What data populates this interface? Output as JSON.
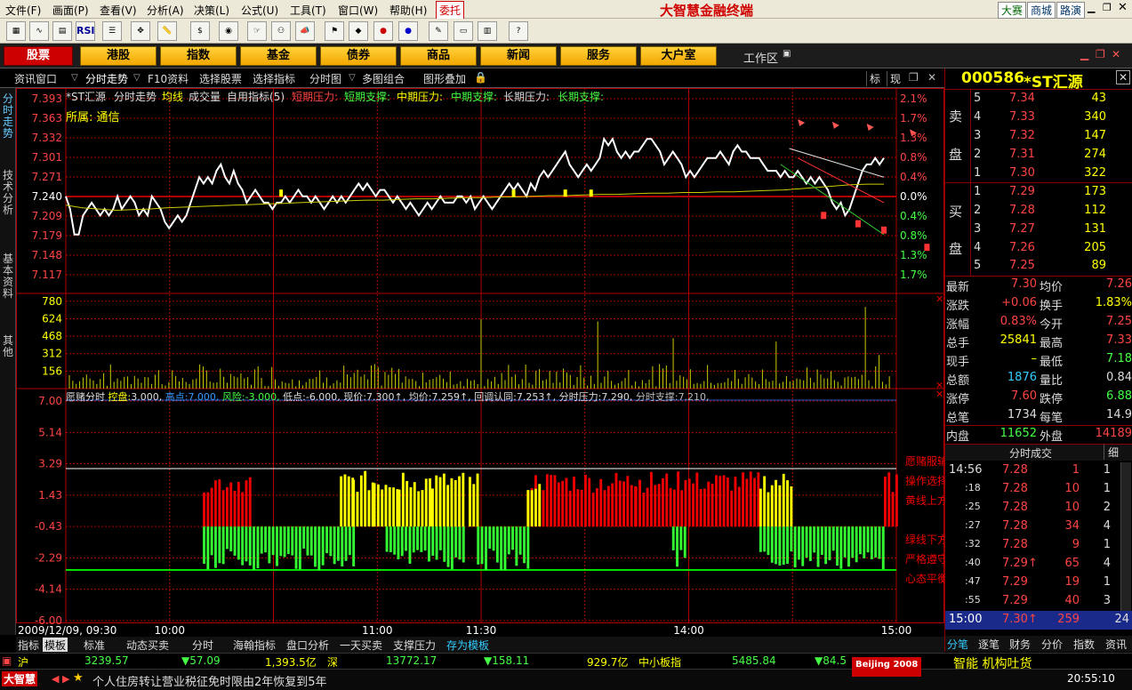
{
  "menu": {
    "items": [
      "文件(F)",
      "画面(P)",
      "查看(V)",
      "分析(A)",
      "决策(L)",
      "公式(U)",
      "工具(T)",
      "窗口(W)",
      "帮助(H)"
    ],
    "entrust": "委托",
    "app_title": "大智慧金融终端",
    "links": [
      "大赛",
      "商城",
      "路演"
    ]
  },
  "toolbar": {
    "rsi": "RSI"
  },
  "nav": {
    "buttons": [
      "股票",
      "港股",
      "指数",
      "基金",
      "债券",
      "商品",
      "新闻",
      "服务",
      "大户室"
    ],
    "workspace": "工作区"
  },
  "subtabs": {
    "items": [
      "资讯窗口",
      "分时走势",
      "F10资料",
      "选择股票",
      "选择指标",
      "分时图",
      "多图组合",
      "图形叠加"
    ],
    "right": [
      "标",
      "现"
    ]
  },
  "stock": {
    "code": "000586",
    "name": "*ST汇源"
  },
  "chart_header": {
    "name": "*ST汇源",
    "items": [
      "分时走势",
      "均线",
      "成交量",
      "自用指标(5)"
    ],
    "pressure": [
      "短期压力:",
      "短期支撑:",
      "中期压力:",
      "中期支撑:",
      "长期压力:",
      "长期支撑:"
    ],
    "sector": "所属: 通信"
  },
  "side_tabs": [
    "分时走势",
    "技术分析",
    "基本资料",
    "其他"
  ],
  "indicator_header": {
    "name": "愿赌分时",
    "kp_label": "控盘:",
    "kp": "3.000,",
    "high_label": "高点:",
    "high": "7.000,",
    "risk_label": "风险:",
    "risk": "-3.000,",
    "low_label": "低点:",
    "low": "-6.000,",
    "price_label": "现价:",
    "price": "7.300↑,",
    "avg_label": "均价:",
    "avg": "7.259↑,",
    "pull_label": "回调认同:",
    "pull": "7.253↑,",
    "press_label": "分时压力:",
    "press": "7.290,",
    "supp_label": "分时支撑:",
    "supp": "7.210,"
  },
  "right_notes": [
    "愿赌服输",
    "操作选择",
    "黄线上方",
    "绿线下方",
    "严格遵守",
    "心态平衡"
  ],
  "chart_data": [
    {
      "type": "line",
      "chart": "price",
      "ylim": [
        7.117,
        7.393
      ],
      "y_ticks_left": [
        "7.393",
        "7.363",
        "7.332",
        "7.301",
        "7.271",
        "7.240",
        "7.209",
        "7.179",
        "7.148",
        "7.117"
      ],
      "y_ticks_right": [
        "2.1%",
        "1.7%",
        "1.3%",
        "0.8%",
        "0.4%",
        "0.0%",
        "0.4%",
        "0.8%",
        "1.3%",
        "1.7%"
      ],
      "prev_close": 7.24,
      "series": [
        {
          "values": [
            7.24,
            7.22,
            7.18,
            7.18,
            7.21,
            7.22,
            7.23,
            7.22,
            7.21,
            7.22,
            7.21,
            7.22,
            7.24,
            7.22,
            7.23,
            7.24,
            7.23,
            7.21,
            7.22,
            7.21,
            7.24,
            7.23,
            7.22,
            7.2,
            7.19,
            7.2,
            7.21,
            7.2,
            7.21,
            7.23,
            7.25,
            7.27,
            7.26,
            7.27,
            7.26,
            7.28,
            7.29,
            7.27,
            7.26,
            7.28,
            7.26,
            7.25,
            7.23,
            7.24,
            7.25,
            7.24,
            7.23,
            7.23,
            7.22,
            7.23,
            7.23,
            7.24,
            7.23,
            7.24,
            7.25,
            7.24,
            7.24,
            7.23,
            7.24,
            7.23,
            7.22,
            7.23,
            7.24,
            7.23,
            7.24,
            7.23,
            7.24,
            7.25,
            7.26,
            7.25,
            7.26,
            7.25,
            7.24,
            7.25,
            7.25,
            7.24,
            7.23,
            7.24,
            7.23,
            7.22,
            7.23,
            7.22,
            7.21,
            7.22,
            7.23,
            7.22,
            7.23,
            7.24,
            7.23,
            7.23,
            7.23,
            7.24,
            7.24,
            7.23,
            7.24,
            7.22,
            7.23,
            7.24,
            7.23,
            7.22,
            7.23,
            7.24,
            7.25,
            7.26,
            7.25,
            7.26,
            7.25,
            7.24,
            7.26,
            7.25,
            7.27,
            7.28,
            7.27,
            7.28,
            7.29,
            7.3,
            7.31,
            7.29,
            7.28,
            7.27,
            7.28,
            7.29,
            7.28,
            7.29,
            7.3,
            7.33,
            7.32,
            7.33,
            7.31,
            7.3,
            7.31,
            7.3,
            7.31,
            7.31,
            7.32,
            7.33,
            7.33,
            7.32,
            7.31,
            7.29,
            7.3,
            7.31,
            7.3,
            7.29,
            7.27,
            7.28,
            7.27,
            7.28,
            7.29,
            7.3,
            7.3,
            7.3,
            7.31,
            7.3,
            7.29,
            7.31,
            7.32,
            7.31,
            7.31,
            7.3,
            7.3,
            7.3,
            7.29,
            7.28,
            7.28,
            7.28,
            7.27,
            7.28,
            7.27,
            7.27,
            7.28,
            7.27,
            7.26,
            7.27,
            7.26,
            7.27,
            7.26,
            7.25,
            7.23,
            7.22,
            7.23,
            7.21,
            7.22,
            7.24,
            7.26,
            7.28,
            7.29,
            7.29,
            7.3,
            7.29,
            7.3
          ]
        },
        {
          "values": [
            7.226,
            7.222,
            7.22,
            7.218,
            7.219,
            7.22,
            7.222,
            7.223,
            7.224,
            7.225,
            7.226,
            7.227,
            7.228,
            7.229,
            7.23,
            7.231,
            7.232,
            7.233,
            7.234,
            7.234,
            7.235,
            7.236,
            7.236,
            7.237,
            7.238,
            7.238,
            7.239,
            7.239,
            7.24,
            7.241,
            7.241,
            7.242,
            7.243,
            7.243,
            7.244,
            7.245,
            7.245,
            7.246,
            7.246,
            7.247,
            7.247,
            7.248,
            7.249,
            7.25,
            7.252,
            7.254,
            7.256,
            7.258,
            7.259,
            7.259
          ]
        }
      ],
      "markers_up": [
        [
          170,
          7.361
        ],
        [
          178,
          7.357
        ],
        [
          186,
          7.354
        ],
        [
          196,
          7.345
        ]
      ],
      "markers_down": [
        [
          176,
          7.21
        ],
        [
          184,
          7.197
        ],
        [
          190,
          7.187
        ],
        [
          200,
          7.16
        ]
      ]
    },
    {
      "type": "bar",
      "chart": "volume",
      "ylim": [
        0,
        850
      ],
      "y_ticks": [
        "780",
        "624",
        "468",
        "312",
        "156"
      ]
    },
    {
      "type": "bar",
      "chart": "indicator",
      "ylim": [
        -6,
        7
      ],
      "y_ticks": [
        "7.00",
        "5.14",
        "3.29",
        "1.43",
        "-0.43",
        "-2.29",
        "-4.14",
        "-6.00"
      ],
      "kp_line": 3.0,
      "risk_line": -3.0
    }
  ],
  "x_axis": {
    "date_label": "2009/12/09, 09:30",
    "ticks": [
      "10:00",
      "11:00",
      "11:30",
      "14:00",
      "15:00"
    ]
  },
  "bottom_tabs": [
    "指标",
    "模板",
    "标准",
    "动态买卖",
    "分时",
    "海翰指标",
    "盘口分析",
    "一天买卖",
    "支撑压力",
    "存为模板"
  ],
  "orderbook": {
    "sell_label": [
      "卖",
      "盘"
    ],
    "buy_label": [
      "买",
      "盘"
    ],
    "asks": [
      {
        "level": "5",
        "price": "7.34",
        "vol": "43"
      },
      {
        "level": "4",
        "price": "7.33",
        "vol": "340"
      },
      {
        "level": "3",
        "price": "7.32",
        "vol": "147"
      },
      {
        "level": "2",
        "price": "7.31",
        "vol": "274"
      },
      {
        "level": "1",
        "price": "7.30",
        "vol": "322"
      }
    ],
    "bids": [
      {
        "level": "1",
        "price": "7.29",
        "vol": "173"
      },
      {
        "level": "2",
        "price": "7.28",
        "vol": "112"
      },
      {
        "level": "3",
        "price": "7.27",
        "vol": "131"
      },
      {
        "level": "4",
        "price": "7.26",
        "vol": "205"
      },
      {
        "level": "5",
        "price": "7.25",
        "vol": "89"
      }
    ]
  },
  "quote": [
    {
      "l1": "最新",
      "v1": "7.30",
      "l2": "均价",
      "v2": "7.26"
    },
    {
      "l1": "涨跌",
      "v1": "+0.06",
      "l2": "换手",
      "v2": "1.83%"
    },
    {
      "l1": "涨幅",
      "v1": "0.83%",
      "l2": "今开",
      "v2": "7.25"
    },
    {
      "l1": "总手",
      "v1": "25841",
      "l2": "最高",
      "v2": "7.33"
    },
    {
      "l1": "现手",
      "v1": "–",
      "l2": "最低",
      "v2": "7.18"
    },
    {
      "l1": "总额",
      "v1": "1876",
      "l2": "量比",
      "v2": "0.84"
    },
    {
      "l1": "涨停",
      "v1": "7.60",
      "l2": "跌停",
      "v2": "6.88"
    },
    {
      "l1": "总笔",
      "v1": "1734",
      "l2": "每笔",
      "v2": "14.9"
    },
    {
      "l1": "内盘",
      "v1": "11652",
      "l2": "外盘",
      "v2": "14189"
    }
  ],
  "ticks_title": "分时成交",
  "ticks_detail": "细",
  "ticks": [
    {
      "t": "14:56",
      "p": "7.28",
      "v": "1",
      "n": "1"
    },
    {
      "t": ":18",
      "p": "7.28",
      "v": "10",
      "n": "1"
    },
    {
      "t": ":25",
      "p": "7.28",
      "v": "10",
      "n": "2"
    },
    {
      "t": ":27",
      "p": "7.28",
      "v": "34",
      "n": "4"
    },
    {
      "t": ":32",
      "p": "7.28",
      "v": "9",
      "n": "1"
    },
    {
      "t": ":40",
      "p": "7.29↑",
      "v": "65",
      "n": "4"
    },
    {
      "t": ":47",
      "p": "7.29",
      "v": "19",
      "n": "1"
    },
    {
      "t": ":55",
      "p": "7.29",
      "v": "40",
      "n": "3"
    },
    {
      "t": "15:00",
      "p": "7.30↑",
      "v": "259",
      "n": "24"
    }
  ],
  "right_tabs": [
    "分笔",
    "逐笔",
    "财务",
    "分价",
    "指数",
    "资讯"
  ],
  "ticker": {
    "sh_label": "沪",
    "sh_index": "3239.57",
    "sh_change": "▼57.09",
    "sh_amount": "1,393.5亿",
    "sz_label": "深",
    "sz_index": "13772.17",
    "sz_change": "▼158.11",
    "sz_amount": "929.7亿",
    "sme_label": "中小板指",
    "sme_index": "5485.84",
    "sme_change": "▼84.5"
  },
  "news": {
    "logo": "大智慧",
    "text": "个人住房转让营业税征免时限由2年恢复到5年",
    "right": "智能 机构吐货",
    "time": "20:55:10",
    "beijing": "Beijing 2008"
  }
}
